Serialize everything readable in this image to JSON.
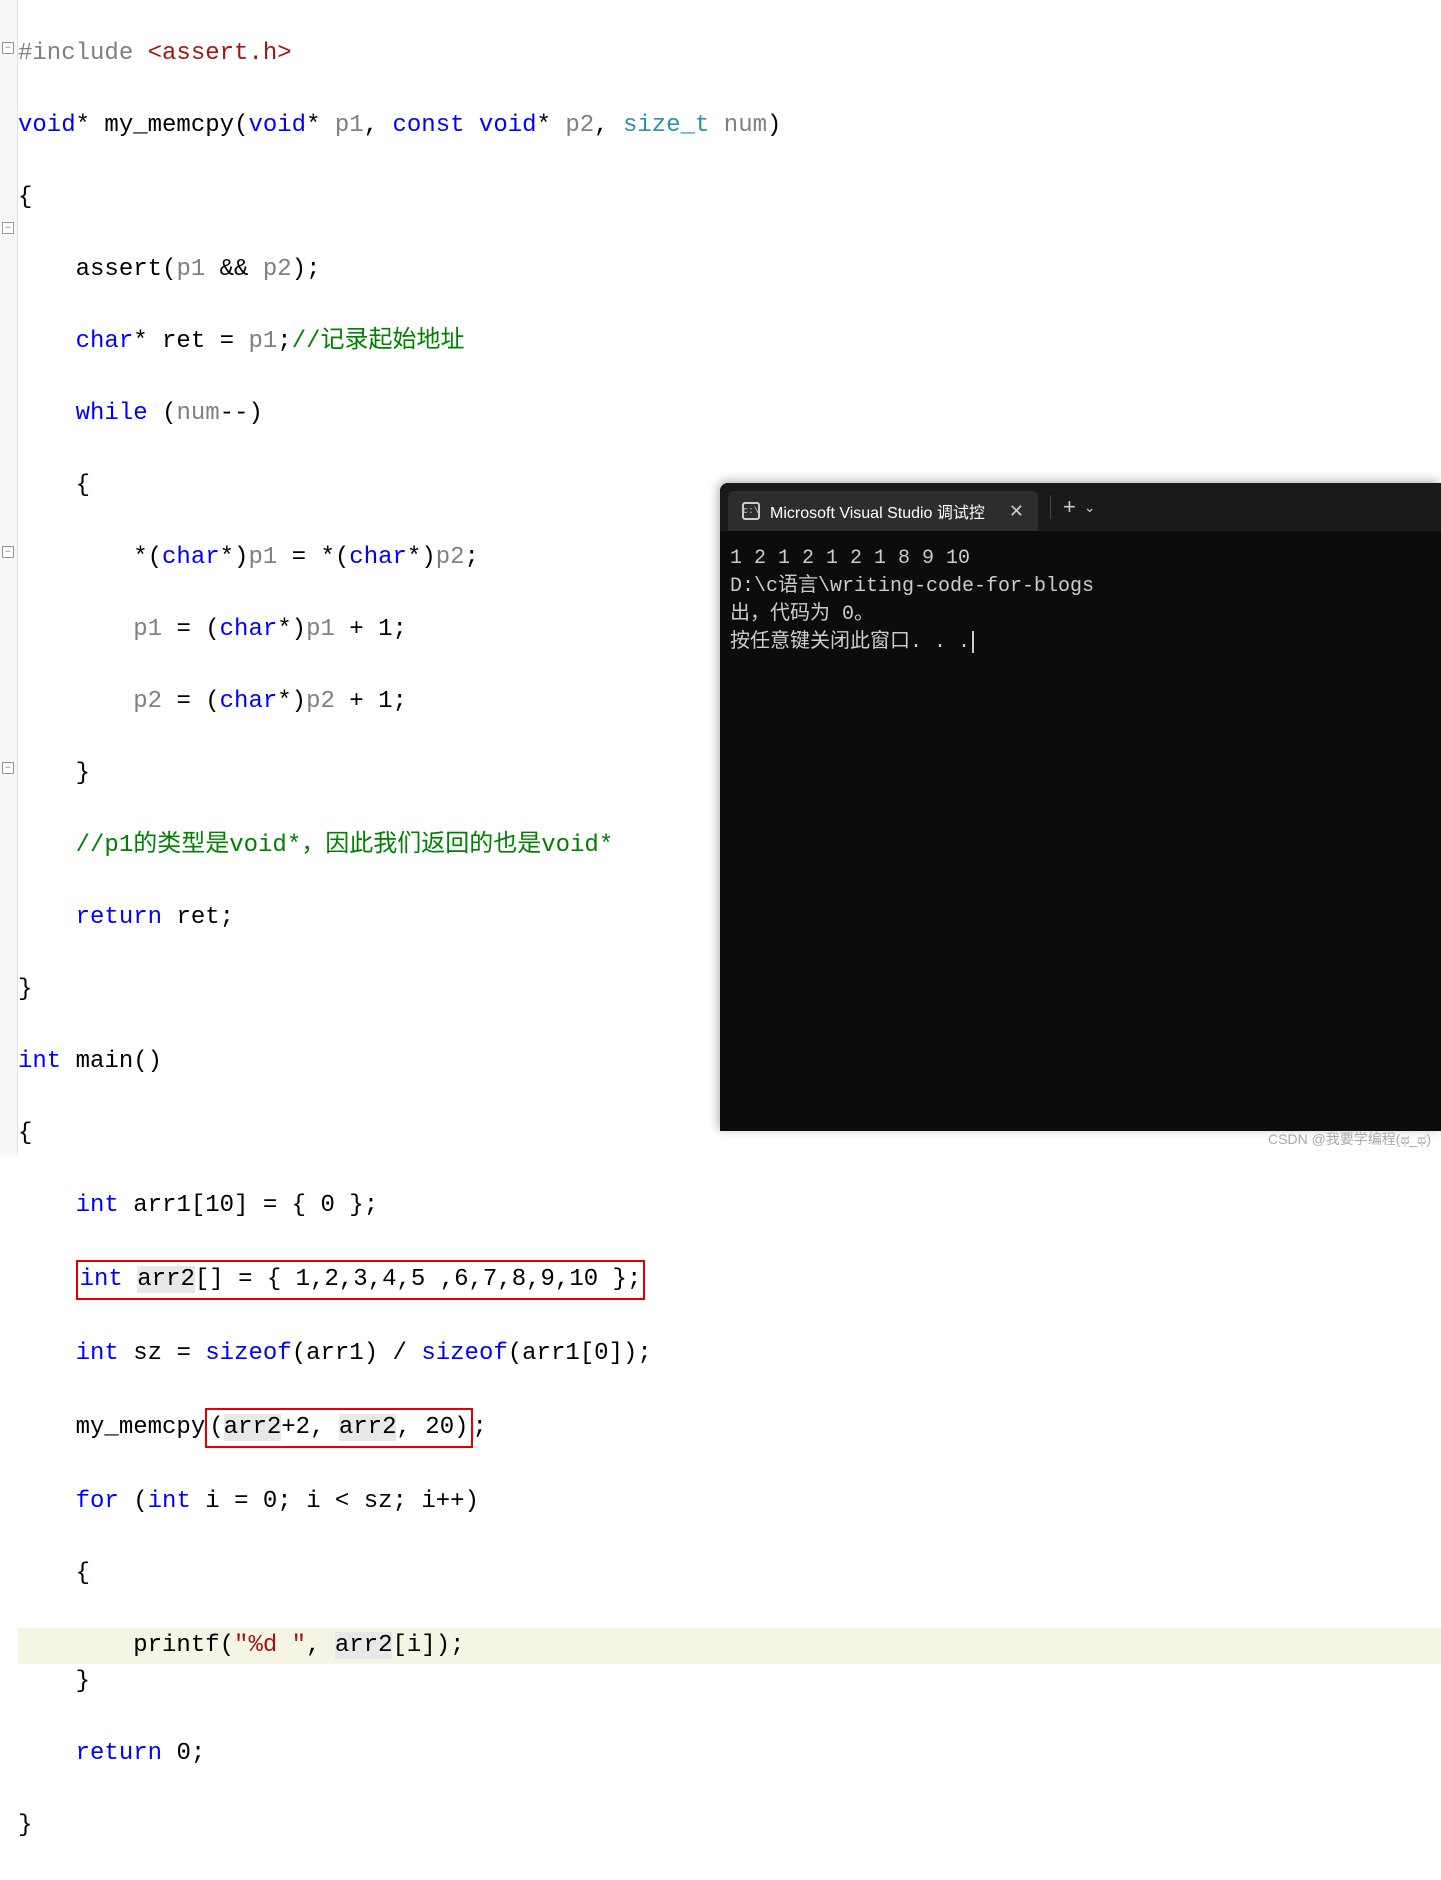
{
  "code": {
    "include_pp": "#include",
    "include_file": "<assert.h>",
    "void_kw": "void",
    "star": "*",
    "fn_name": "my_memcpy",
    "p1": "p1",
    "p2": "p2",
    "const_kw": "const",
    "sizet": "size_t",
    "num": "num",
    "obrace": "{",
    "cbrace": "}",
    "assert_call": "assert",
    "and_op": "&&",
    "semi": ";",
    "char_kw": "char",
    "ret": "ret",
    "eq": "=",
    "comment1": "//记录起始地址",
    "while_kw": "while",
    "decrement": "--",
    "cast_char": "char",
    "plus_one": " + 1",
    "one": "1",
    "comment2": "//p1的类型是void*，因此我们返回的也是void*",
    "return_kw": "return",
    "int_kw": "int",
    "main": "main",
    "arr1_decl": "arr1[10]",
    "arr1_init": "{ 0 }",
    "arr1_name": "arr1",
    "arr2_name": "arr2",
    "arr2_decl": "arr2[]",
    "arr2_init": "{ 1,2,3,4,5 ,6,7,8,9,10 }",
    "sz": "sz",
    "sizeof_kw": "sizeof",
    "arr1_sub0": "arr1[0]",
    "memcpy_call": "my_memcpy",
    "plus2": "+2",
    "twenty": "20",
    "for_kw": "for",
    "i": "i",
    "zero": "0",
    "lt": "<",
    "inc": "++",
    "printf": "printf",
    "fmt": "\"%d \"",
    "arr2_i": "arr2[i]",
    "return_zero": "0"
  },
  "terminal": {
    "tab_title": "Microsoft Visual Studio 调试控",
    "output_line1": "1 2 1 2 1 2 1 8 9 10",
    "output_line2": "D:\\c语言\\writing-code-for-blogs",
    "output_line3": "出，代码为 0。",
    "output_line4": "按任意键关闭此窗口. . ."
  },
  "watermark": "CSDN @我要学编程(ಥ_ಥ)"
}
